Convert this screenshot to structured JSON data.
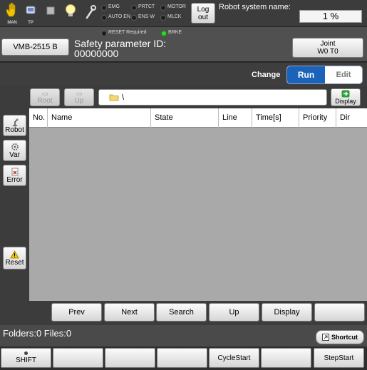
{
  "topbar": {
    "mode_man": "MAN",
    "mode_tp": "TP",
    "lamps": {
      "emg": "EMG",
      "autoen": "AUTO EN",
      "prtct": "PRTCT",
      "ensw": "ENS W",
      "motor": "MOTOR",
      "mlck": "MLCK",
      "reset_required": "RESET Required",
      "brke": "BRKE"
    },
    "logout_line1": "Log",
    "logout_line2": "out",
    "robot_name_label": "Robot system name:",
    "progress_text": "1 %",
    "progress_value": 0.01
  },
  "row2": {
    "model_button": "VMB-2515 B",
    "safety_label": "Safety parameter ID:",
    "safety_id": "00000000",
    "joint_line1": "Joint",
    "joint_line2": "W0 T0"
  },
  "changebar": {
    "label": "Change",
    "run": "Run",
    "edit": "Edit"
  },
  "toolbar": {
    "root": "Root",
    "up": "Up",
    "path": "\\",
    "display": "Display"
  },
  "side": {
    "robot": "Robot",
    "var": "Var",
    "error": "Error",
    "reset": "Reset"
  },
  "table": {
    "columns": [
      "No.",
      "Name",
      "State",
      "Line",
      "Time[s]",
      "Priority",
      "Dir"
    ],
    "rows": []
  },
  "nav": [
    "Prev",
    "Next",
    "Search",
    "Up",
    "Display",
    ""
  ],
  "status": {
    "counts": "Folders:0  Files:0",
    "shortcut": "Shortcut"
  },
  "footer": [
    "SHIFT",
    "",
    "",
    "",
    "CycleStart",
    "",
    "StepStart"
  ],
  "colors": {
    "run_accent": "#1a63b8",
    "lamp_on": "#32d232",
    "table_bg": "#a9a9a9"
  }
}
